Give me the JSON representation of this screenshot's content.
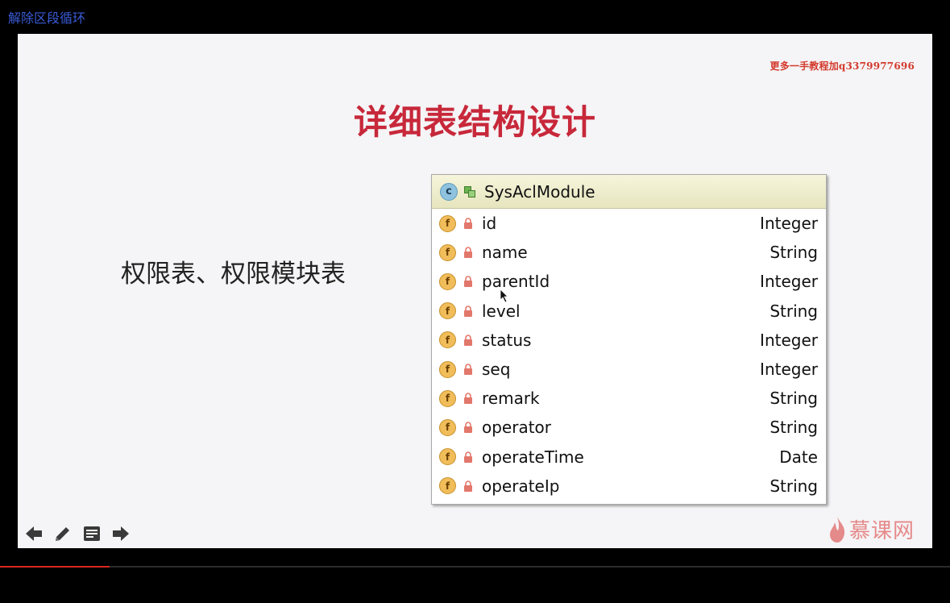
{
  "top_link": "解除区段循环",
  "slide": {
    "watermark": "更多一手教程加q3379977696",
    "title": "详细表结构设计",
    "subtitle": "权限表、权限模块表",
    "logo_text": "慕课网"
  },
  "class_panel": {
    "class_icon_letter": "c",
    "class_name": "SysAclModule",
    "field_icon_letter": "f",
    "fields": [
      {
        "name": "id",
        "type": "Integer"
      },
      {
        "name": "name",
        "type": "String"
      },
      {
        "name": "parentId",
        "type": "Integer"
      },
      {
        "name": "level",
        "type": "String"
      },
      {
        "name": "status",
        "type": "Integer"
      },
      {
        "name": "seq",
        "type": "Integer"
      },
      {
        "name": "remark",
        "type": "String"
      },
      {
        "name": "operator",
        "type": "String"
      },
      {
        "name": "operateTime",
        "type": "Date"
      },
      {
        "name": "operateIp",
        "type": "String"
      }
    ]
  },
  "nav": {
    "icons": [
      "arrow-left-icon",
      "pencil-icon",
      "notes-icon",
      "arrow-right-icon"
    ]
  },
  "playback": {
    "progress": 0.115
  },
  "colors": {
    "title": "#c7283a",
    "watermark": "#d33a2c",
    "class_header": "#eeedcc",
    "field_icon": "#f0bd5a",
    "class_icon": "#8ec2de",
    "progress": "#d9271f"
  }
}
